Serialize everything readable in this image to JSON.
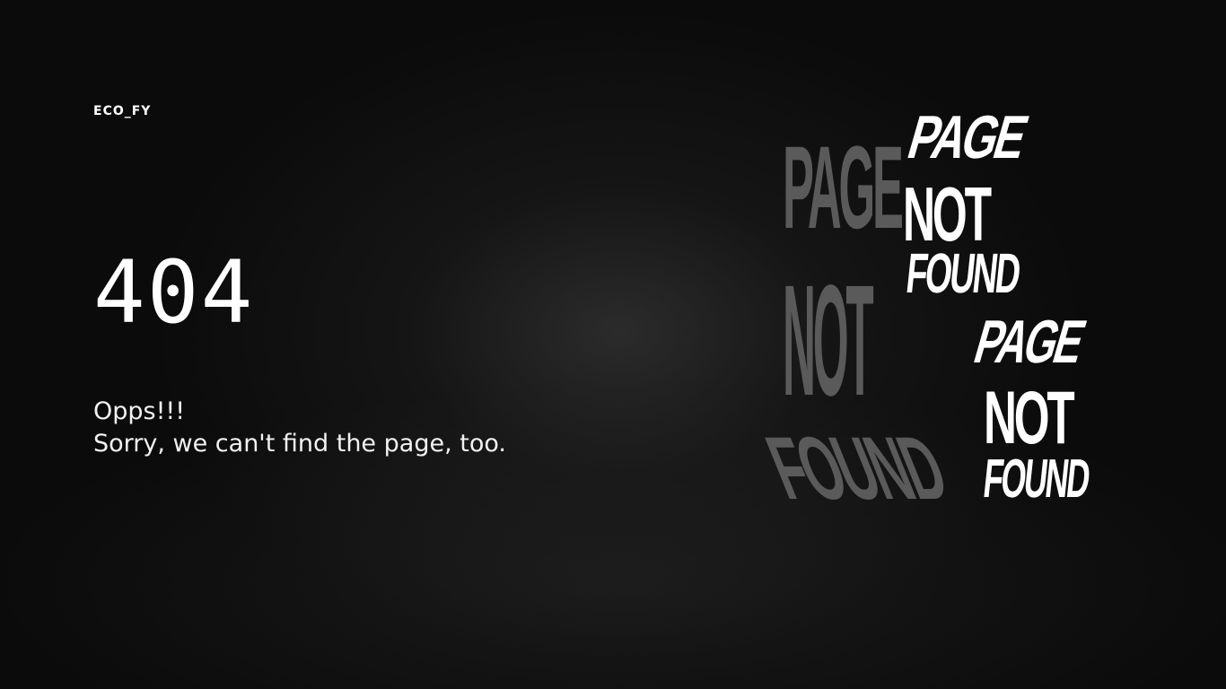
{
  "brand": {
    "name": "ECO_FY"
  },
  "error": {
    "code": "404",
    "line1": "Opps!!!",
    "line2": "Sorry, we can't find the page, too."
  },
  "art": {
    "ghost": {
      "line1": "PAGE",
      "line2": "NOT",
      "line3": "FOUND"
    },
    "top": {
      "line1": "PAGE",
      "line2": "NOT",
      "line3": "FOUND"
    },
    "bottom": {
      "line1": "PAGE",
      "line2": "NOT",
      "line3": "FOUND"
    }
  },
  "colors": {
    "background": "#0b0b0b",
    "text": "#ffffff",
    "ghost_text": "#5a5a5a"
  }
}
